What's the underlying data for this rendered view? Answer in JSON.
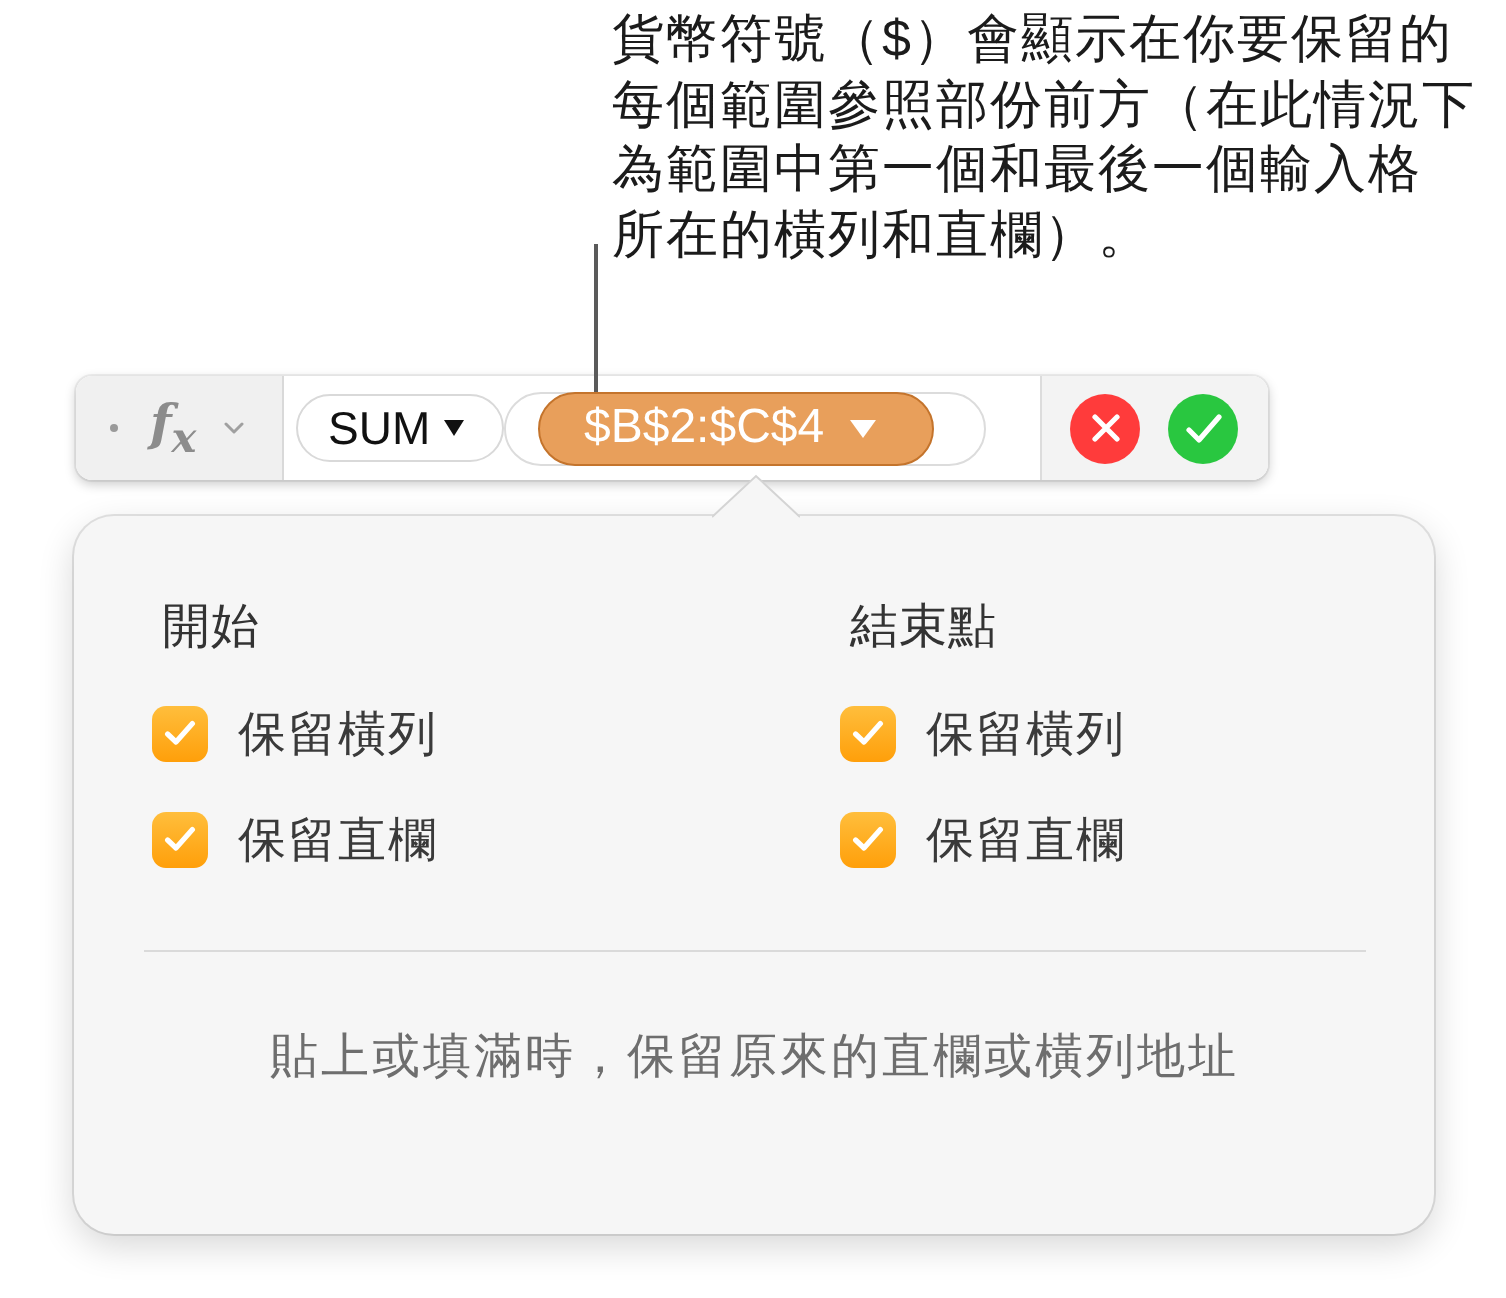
{
  "callout": {
    "lines": [
      "貨幣符號（$）會顯示在你要保留的",
      "每個範圍參照部份前方（在此情況下",
      "為範圍中第一個和最後一個輸入格",
      "所在的橫列和直欄）。"
    ]
  },
  "formula_bar": {
    "function_button": "f$_{x}$",
    "function_token": {
      "label": "SUM",
      "selected": false
    },
    "range_token": {
      "label": "$B$2:$C$4",
      "selected": true
    }
  },
  "popover": {
    "columns": [
      {
        "heading": "開始",
        "options": [
          {
            "label": "保留橫列",
            "checked": true
          },
          {
            "label": "保留直欄",
            "checked": true
          }
        ]
      },
      {
        "heading": "結束點",
        "options": [
          {
            "label": "保留橫列",
            "checked": true
          },
          {
            "label": "保留直欄",
            "checked": true
          }
        ]
      }
    ],
    "footer_note": "貼上或填滿時，保留原來的直欄或橫列地址"
  }
}
